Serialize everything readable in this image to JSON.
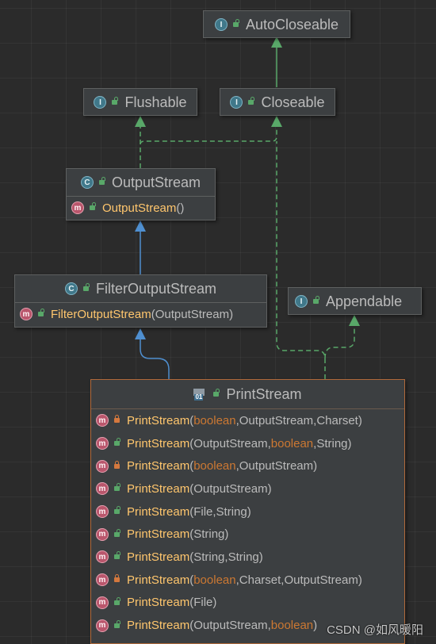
{
  "diagram": {
    "nodes": {
      "autocloseable": {
        "kind": "interface",
        "name": "AutoCloseable",
        "icon": "interface-icon"
      },
      "flushable": {
        "kind": "interface",
        "name": "Flushable",
        "icon": "interface-icon"
      },
      "closeable": {
        "kind": "interface",
        "name": "Closeable",
        "icon": "interface-icon"
      },
      "outputstream": {
        "kind": "abstract-class",
        "name": "OutputStream",
        "icon": "class-icon",
        "methods": [
          {
            "name": "OutputStream",
            "params": "()"
          }
        ]
      },
      "appendable": {
        "kind": "interface",
        "name": "Appendable",
        "icon": "interface-icon"
      },
      "filteroutputstream": {
        "kind": "class",
        "name": "FilterOutputStream",
        "icon": "class-icon",
        "methods": [
          {
            "name": "FilterOutputStream",
            "params": "(OutputStream)"
          }
        ]
      },
      "printstream": {
        "kind": "class",
        "name": "PrintStream",
        "icon": "class-file-icon",
        "methods": [
          {
            "name": "PrintStream",
            "access": "private",
            "p": [
              {
                "t": "boolean",
                "kw": true
              },
              {
                "t": "OutputStream"
              },
              {
                "t": "Charset"
              }
            ]
          },
          {
            "name": "PrintStream",
            "access": "public",
            "p": [
              {
                "t": "OutputStream"
              },
              {
                "t": "boolean",
                "kw": true
              },
              {
                "t": "String"
              }
            ]
          },
          {
            "name": "PrintStream",
            "access": "private",
            "p": [
              {
                "t": "boolean",
                "kw": true
              },
              {
                "t": "OutputStream"
              }
            ]
          },
          {
            "name": "PrintStream",
            "access": "public",
            "p": [
              {
                "t": "OutputStream"
              }
            ]
          },
          {
            "name": "PrintStream",
            "access": "public",
            "p": [
              {
                "t": "File"
              },
              {
                "t": "String"
              }
            ]
          },
          {
            "name": "PrintStream",
            "access": "public",
            "p": [
              {
                "t": "String"
              }
            ]
          },
          {
            "name": "PrintStream",
            "access": "public",
            "p": [
              {
                "t": "String"
              },
              {
                "t": "String"
              }
            ]
          },
          {
            "name": "PrintStream",
            "access": "private",
            "p": [
              {
                "t": "boolean",
                "kw": true
              },
              {
                "t": "Charset"
              },
              {
                "t": "OutputStream"
              }
            ]
          },
          {
            "name": "PrintStream",
            "access": "public",
            "p": [
              {
                "t": "File"
              }
            ]
          },
          {
            "name": "PrintStream",
            "access": "public",
            "p": [
              {
                "t": "OutputStream"
              },
              {
                "t": "boolean",
                "kw": true
              }
            ]
          }
        ]
      }
    },
    "edges": [
      {
        "from": "Closeable",
        "to": "AutoCloseable",
        "type": "extends"
      },
      {
        "from": "OutputStream",
        "to": "Flushable",
        "type": "implements"
      },
      {
        "from": "OutputStream",
        "to": "Closeable",
        "type": "implements"
      },
      {
        "from": "FilterOutputStream",
        "to": "OutputStream",
        "type": "extends"
      },
      {
        "from": "PrintStream",
        "to": "FilterOutputStream",
        "type": "extends"
      },
      {
        "from": "PrintStream",
        "to": "Appendable",
        "type": "implements"
      },
      {
        "from": "PrintStream",
        "to": "Closeable",
        "type": "implements"
      }
    ],
    "colors": {
      "extends_interface": "#59a869",
      "extends_class": "#4f8fd0",
      "implements": "#59a869",
      "selected_border": "#b0693a"
    }
  },
  "watermark": "CSDN @如风暖阳"
}
